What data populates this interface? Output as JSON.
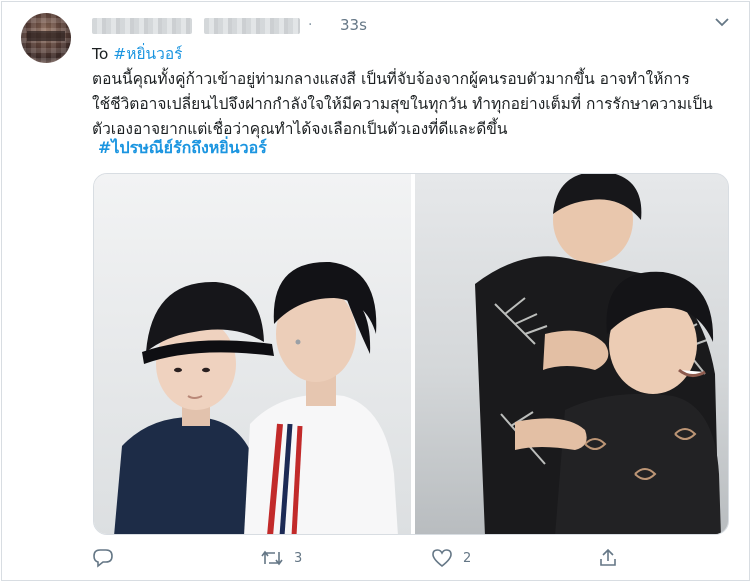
{
  "tweet": {
    "time": "33s",
    "separator": "·",
    "to_prefix": "To",
    "to_hashtag": "#หยิ่นวอร์",
    "body_lines": [
      "ตอนนี้คุณทั้งคู่ก้าวเข้าอยู่ท่ามกลางแสงสี เป็นที่จับจ้องจากผู้คนรอบตัวมากขึ้น อาจทำให้การ",
      "ใช้ชีวิตอาจเปลี่ยนไปจึงฝากกำลังใจให้มีความสุขในทุกวัน ทำทุกอย่างเต็มที่ การรักษาความเป็น",
      "ตัวเองอาจยากแต่เชื่อว่าคุณทำได้จงเลือกเป็นตัวเองที่ดีและดีขึ้น"
    ],
    "hashtag_2": "#ไปรษณีย์รักถึงหยิ่นวอร์"
  },
  "actions": {
    "reply_icon": "reply-icon",
    "retweet_icon": "retweet-icon",
    "retweet_count": "3",
    "like_icon": "heart-icon",
    "like_count": "2",
    "share_icon": "share-icon"
  },
  "colors": {
    "link": "#1b95e0",
    "muted": "#657786",
    "border": "#d8dde2"
  }
}
